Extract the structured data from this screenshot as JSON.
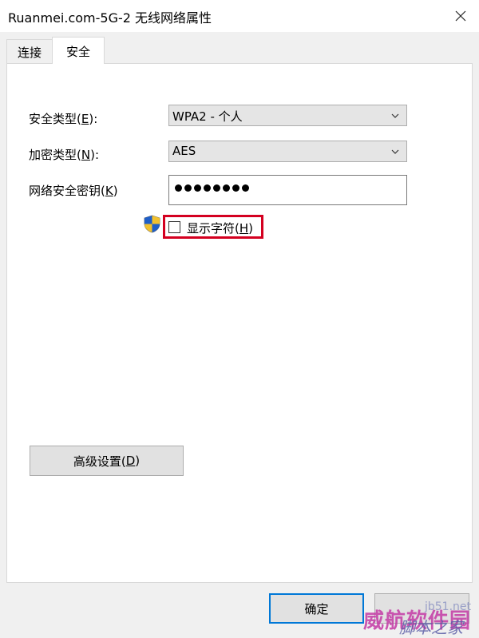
{
  "window": {
    "title": "Ruanmei.com-5G-2 无线网络属性"
  },
  "tabs": [
    {
      "label": "连接"
    },
    {
      "label": "安全"
    }
  ],
  "form": {
    "security_type": {
      "label_prefix": "安全类型(",
      "mnemonic": "E",
      "label_suffix": "):",
      "value": "WPA2 - 个人"
    },
    "encryption_type": {
      "label_prefix": "加密类型(",
      "mnemonic": "N",
      "label_suffix": "):",
      "value": "AES"
    },
    "network_key": {
      "label_prefix": "网络安全密钥(",
      "mnemonic": "K",
      "label_suffix": ")",
      "masked_length": 8
    },
    "show_chars": {
      "label_prefix": "显示字符(",
      "mnemonic": "H",
      "label_suffix": ")",
      "checked": false
    }
  },
  "buttons": {
    "advanced": {
      "label_prefix": "高级设置(",
      "mnemonic": "D",
      "label_suffix": ")"
    },
    "ok": {
      "label": "确定"
    }
  },
  "watermark": {
    "site": "jb51.net",
    "main": "威航软件园",
    "sub": "脚本之家"
  },
  "colors": {
    "highlight": "#d40020",
    "focus": "#0078d7"
  },
  "icons": {
    "close": "close-icon",
    "shield": "uac-shield-icon",
    "dropdown": "chevron-down-icon"
  }
}
